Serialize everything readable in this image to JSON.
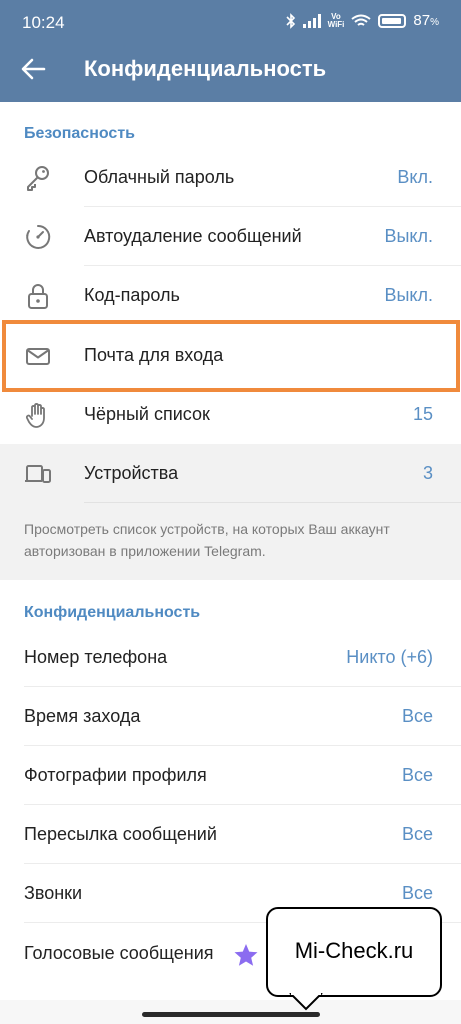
{
  "status_bar": {
    "time": "10:24",
    "battery_pct": "87",
    "battery_suffix": "%",
    "volte": "Vo",
    "wifi_label": "WiFi"
  },
  "header": {
    "title": "Конфиденциальность"
  },
  "security": {
    "heading": "Безопасность",
    "items": [
      {
        "label": "Облачный пароль",
        "value": "Вкл.",
        "icon": "key-icon"
      },
      {
        "label": "Автоудаление сообщений",
        "value": "Выкл.",
        "icon": "timer-icon"
      },
      {
        "label": "Код-пароль",
        "value": "Выкл.",
        "icon": "lock-icon"
      },
      {
        "label": "Почта для входа",
        "value": "",
        "icon": "mail-icon"
      },
      {
        "label": "Чёрный список",
        "value": "15",
        "icon": "hand-icon"
      },
      {
        "label": "Устройства",
        "value": "3",
        "icon": "devices-icon"
      }
    ],
    "note": "Просмотреть список устройств, на которых Ваш аккаунт авторизован в приложении Telegram."
  },
  "privacy": {
    "heading": "Конфиденциальность",
    "items": [
      {
        "label": "Номер телефона",
        "value": "Никто (+6)"
      },
      {
        "label": "Время захода",
        "value": "Все"
      },
      {
        "label": "Фотографии профиля",
        "value": "Все"
      },
      {
        "label": "Пересылка сообщений",
        "value": "Все"
      },
      {
        "label": "Звонки",
        "value": "Все"
      },
      {
        "label": "Голосовые сообщения",
        "value": ""
      }
    ]
  },
  "watermark": {
    "text": "Mi-Check.ru"
  },
  "colors": {
    "header": "#5b7ea5",
    "accent": "#4f8ac2",
    "highlight": "#f08a3c",
    "premium_star": "#8b6cf0"
  }
}
